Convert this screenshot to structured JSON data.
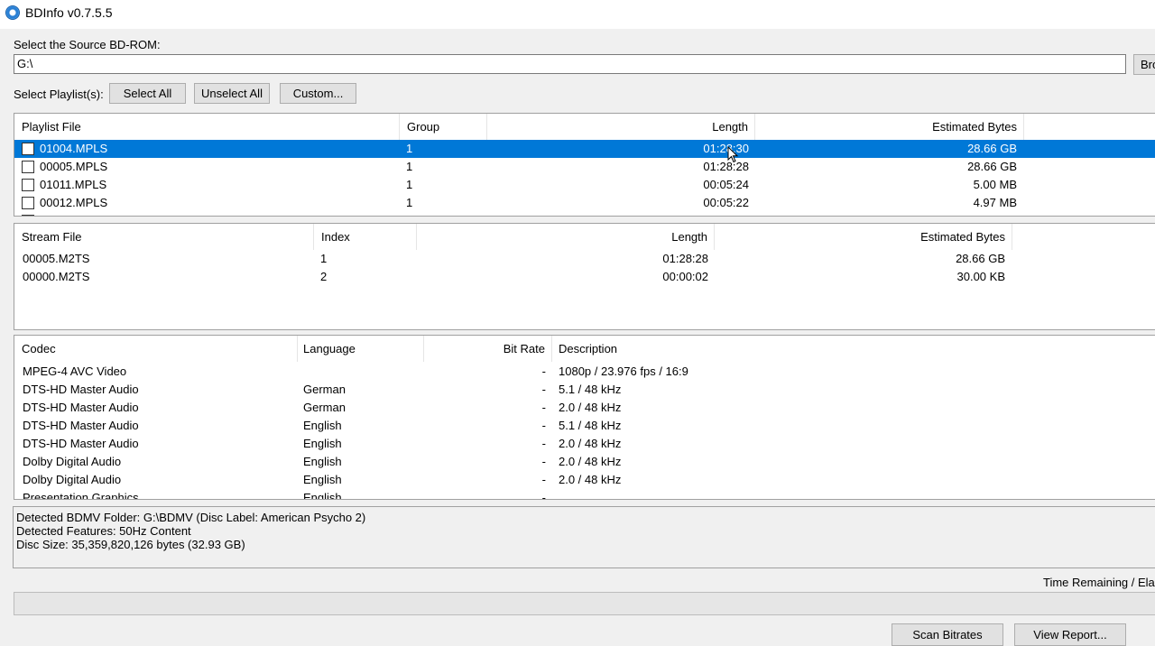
{
  "window": {
    "title": "BDInfo v0.7.5.5"
  },
  "source": {
    "label": "Select the Source BD-ROM:",
    "value": "G:\\",
    "browse_label": "Bro"
  },
  "playlist_select": {
    "label": "Select Playlist(s):",
    "select_all": "Select All",
    "unselect_all": "Unselect All",
    "custom": "Custom..."
  },
  "playlists": {
    "headers": {
      "file": "Playlist File",
      "group": "Group",
      "length": "Length",
      "bytes": "Estimated Bytes"
    },
    "rows": [
      {
        "file": "01004.MPLS",
        "group": "1",
        "length": "01:28:30",
        "bytes": "28.66 GB",
        "selected": true
      },
      {
        "file": "00005.MPLS",
        "group": "1",
        "length": "01:28:28",
        "bytes": "28.66 GB"
      },
      {
        "file": "01011.MPLS",
        "group": "1",
        "length": "00:05:24",
        "bytes": "5.00 MB"
      },
      {
        "file": "00012.MPLS",
        "group": "1",
        "length": "00:05:22",
        "bytes": "4.97 MB"
      }
    ]
  },
  "streams": {
    "headers": {
      "file": "Stream File",
      "index": "Index",
      "length": "Length",
      "bytes": "Estimated Bytes"
    },
    "rows": [
      {
        "file": "00005.M2TS",
        "index": "1",
        "length": "01:28:28",
        "bytes": "28.66 GB"
      },
      {
        "file": "00000.M2TS",
        "index": "2",
        "length": "00:00:02",
        "bytes": "30.00 KB"
      }
    ]
  },
  "codecs": {
    "headers": {
      "codec": "Codec",
      "language": "Language",
      "bitrate": "Bit Rate",
      "description": "Description"
    },
    "rows": [
      {
        "codec": "MPEG-4 AVC Video",
        "language": "",
        "bitrate": "-",
        "description": "1080p / 23.976 fps / 16:9"
      },
      {
        "codec": "DTS-HD Master Audio",
        "language": "German",
        "bitrate": "-",
        "description": "5.1 / 48 kHz"
      },
      {
        "codec": "DTS-HD Master Audio",
        "language": "German",
        "bitrate": "-",
        "description": "2.0 / 48 kHz"
      },
      {
        "codec": "DTS-HD Master Audio",
        "language": "English",
        "bitrate": "-",
        "description": "5.1 / 48 kHz"
      },
      {
        "codec": "DTS-HD Master Audio",
        "language": "English",
        "bitrate": "-",
        "description": "2.0 / 48 kHz"
      },
      {
        "codec": "Dolby Digital Audio",
        "language": "English",
        "bitrate": "-",
        "description": "2.0 / 48 kHz"
      },
      {
        "codec": "Dolby Digital Audio",
        "language": "English",
        "bitrate": "-",
        "description": "2.0 / 48 kHz"
      },
      {
        "codec": "Presentation Graphics",
        "language": "English",
        "bitrate": "-",
        "description": ""
      }
    ]
  },
  "info": {
    "lines": [
      "Detected BDMV Folder: G:\\BDMV (Disc Label: American Psycho 2)",
      "Detected Features: 50Hz Content",
      "Disc Size: 35,359,820,126 bytes (32.93 GB)"
    ]
  },
  "progress": {
    "time_label": "Time Remaining / Elap"
  },
  "actions": {
    "scan": "Scan Bitrates",
    "report": "View Report..."
  },
  "colors": {
    "selection": "#0078d7",
    "button_face": "#e1e1e1"
  }
}
